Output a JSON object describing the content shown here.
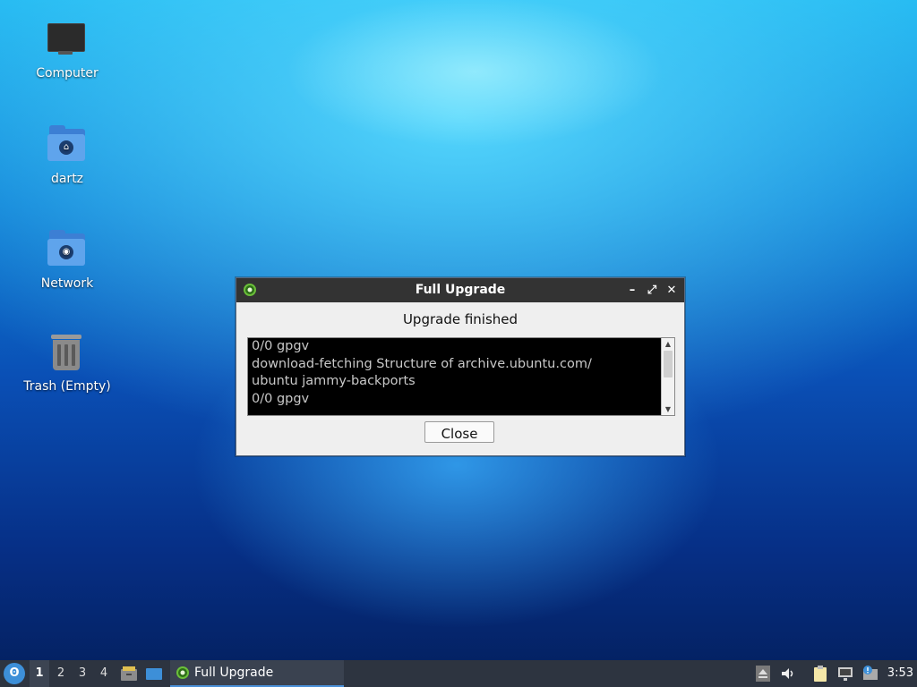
{
  "desktop": {
    "icons": [
      {
        "label": "Computer",
        "icon": "computer-icon"
      },
      {
        "label": "dartz",
        "icon": "home-folder-icon"
      },
      {
        "label": "Network",
        "icon": "network-folder-icon"
      },
      {
        "label": "Trash (Empty)",
        "icon": "trash-icon"
      }
    ]
  },
  "dialog": {
    "title": "Full Upgrade",
    "heading": "Upgrade finished",
    "log_lines": "0/0 gpgv\ndownload-fetching Structure of archive.ubuntu.com/\nubuntu jammy-backports\n0/0 gpgv",
    "close_label": "Close",
    "controls": [
      "minimize-icon",
      "maximize-icon",
      "close-icon"
    ]
  },
  "taskbar": {
    "workspaces": [
      "1",
      "2",
      "3",
      "4"
    ],
    "active_workspace": "1",
    "task_label": "Full Upgrade",
    "clock": "3:53"
  },
  "colors": {
    "titlebar": "#333333",
    "taskbar": "#2d3440",
    "accent": "#4a90d9"
  }
}
